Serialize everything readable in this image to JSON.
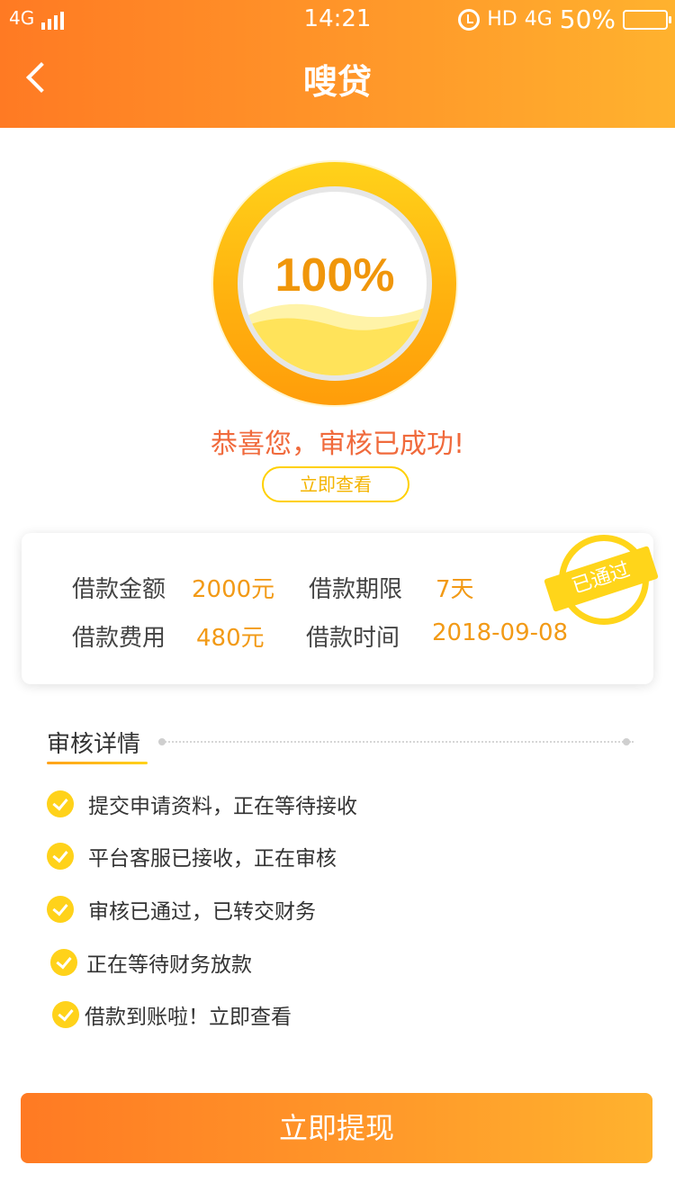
{
  "status_bar": {
    "network": "4G",
    "time": "14:21",
    "hd": "HD",
    "net2": "4G",
    "battery": "50%",
    "battery_level": 0.5
  },
  "header": {
    "title": "嗖贷",
    "back_icon": "chevron-left-icon"
  },
  "progress": {
    "percent_text": "100%",
    "value": 1.0,
    "success_text": "恭喜您，审核已成功!",
    "view_button": "立即查看"
  },
  "loan": {
    "amount_label": "借款金额",
    "amount_value": "2000元",
    "term_label": "借款期限",
    "term_value": "7天",
    "fee_label": "借款费用",
    "fee_value": "480元",
    "date_label": "借款时间",
    "date_value": "2018-09-08",
    "stamp": "已通过"
  },
  "details": {
    "title": "审核详情",
    "steps": [
      "提交申请资料，正在等待接收",
      "平台客服已接收，正在审核",
      "审核已通过，已转交财务",
      "正在等待财务放款",
      "借款到账啦！立即查看"
    ]
  },
  "actions": {
    "withdraw": "立即提现"
  },
  "colors": {
    "accent_start": "#ff7a23",
    "accent_end": "#ffb22e",
    "ring_yellow": "#ffd21a",
    "value_orange": "#f29a16",
    "success_red": "#f06a3c"
  }
}
